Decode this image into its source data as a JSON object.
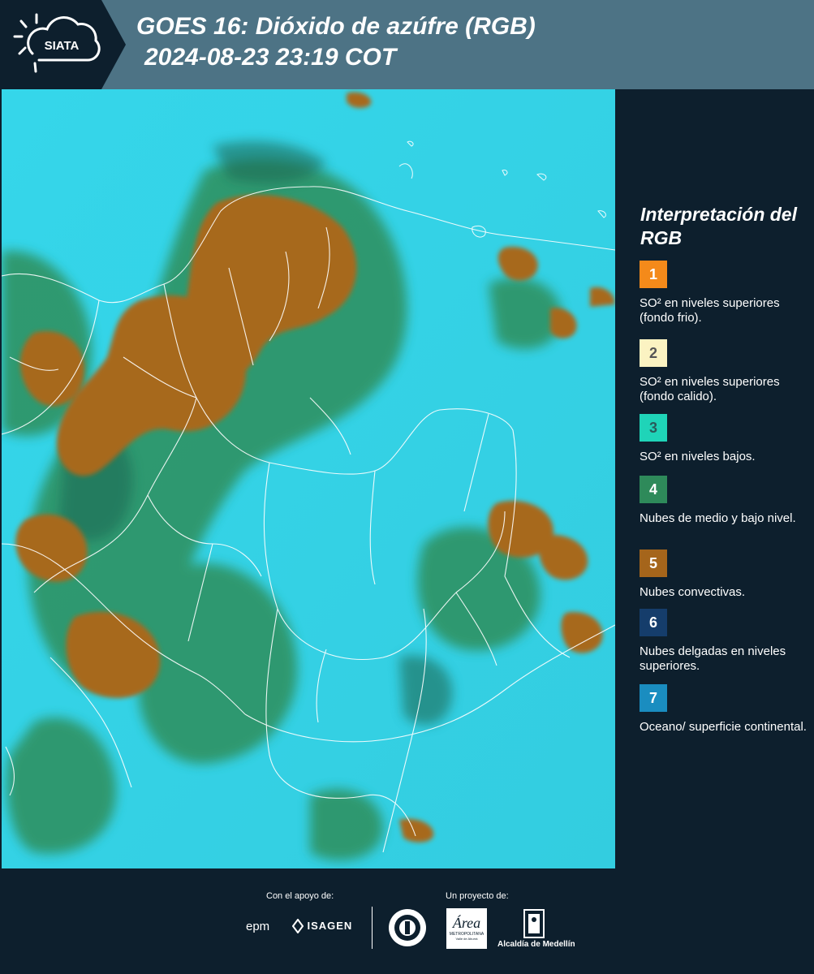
{
  "header": {
    "logo_text": "SIATA",
    "title_line1": "GOES 16: Dióxido de azúfre (RGB)",
    "title_line2": "2024-08-23 23:19 COT"
  },
  "legend": {
    "title": "Interpretación del RGB",
    "items": [
      {
        "number": "1",
        "color": "#f48a1a",
        "text_color": "#ffffff",
        "label": "SO² en niveles superiores (fondo frio)."
      },
      {
        "number": "2",
        "color": "#fbf3c2",
        "text_color": "#555555",
        "label": "SO² en niveles superiores (fondo calido)."
      },
      {
        "number": "3",
        "color": "#1fd4b8",
        "text_color": "#2a5a5a",
        "label": "SO² en niveles bajos."
      },
      {
        "number": "4",
        "color": "#2e8a5a",
        "text_color": "#ffffff",
        "label": "Nubes de medio y bajo nivel."
      },
      {
        "number": "5",
        "color": "#a5651b",
        "text_color": "#ffffff",
        "label": "Nubes convectivas."
      },
      {
        "number": "6",
        "color": "#153d6b",
        "text_color": "#ffffff",
        "label": "Nubes delgadas en niveles superiores."
      },
      {
        "number": "7",
        "color": "#1a8dc0",
        "text_color": "#ffffff",
        "label": "Oceano/ superficie continental."
      }
    ]
  },
  "footer": {
    "support_label": "Con el apoyo de:",
    "project_label": "Un proyecto de:",
    "epm": "epm",
    "isagen": "ISAGEN",
    "area_metropolitana": "Área",
    "area_sub": "METROPOLITANA",
    "area_sub2": "Valle de Aburrá",
    "alcaldia": "Alcaldía de Medellín"
  },
  "colors": {
    "header_bg": "#4d7385",
    "panel_bg": "#0d1f2d",
    "ocean": "#2fd2e6",
    "vegetation": "#2e8a5a",
    "convective": "#a5651b"
  }
}
